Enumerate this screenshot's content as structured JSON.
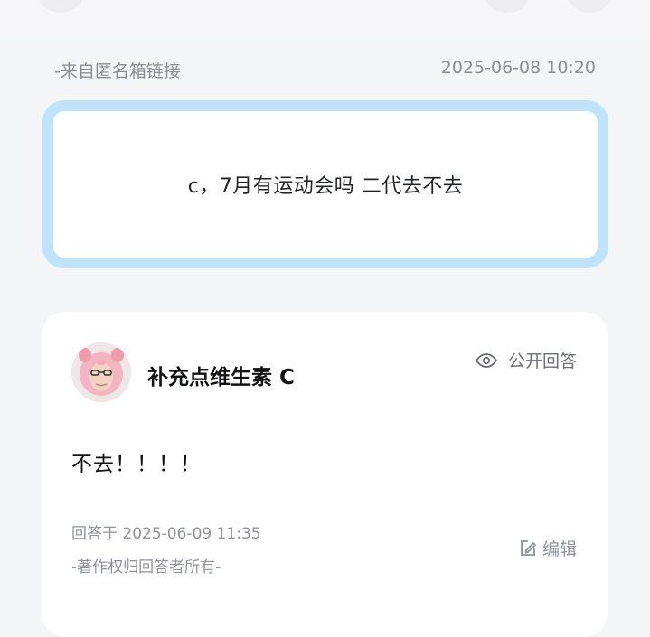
{
  "header": {
    "source": "-来自匿名箱链接",
    "timestamp": "2025-06-08 10:20"
  },
  "question": {
    "text": "c，7月有运动会吗 二代去不去",
    "border_color": "#bfe3fb"
  },
  "answer": {
    "author": "补充点维生素 C",
    "visibility_icon": "eye-icon",
    "visibility_label": "公开回答",
    "text": "不去！！！！",
    "answered_at": "回答于 2025-06-09 11:35",
    "copyright": "-著作权归回答者所有-",
    "edit_icon": "edit-icon",
    "edit_label": "编辑"
  },
  "colors": {
    "background": "#f4f5f7",
    "card": "#ffffff",
    "muted_text": "#8f9297"
  }
}
